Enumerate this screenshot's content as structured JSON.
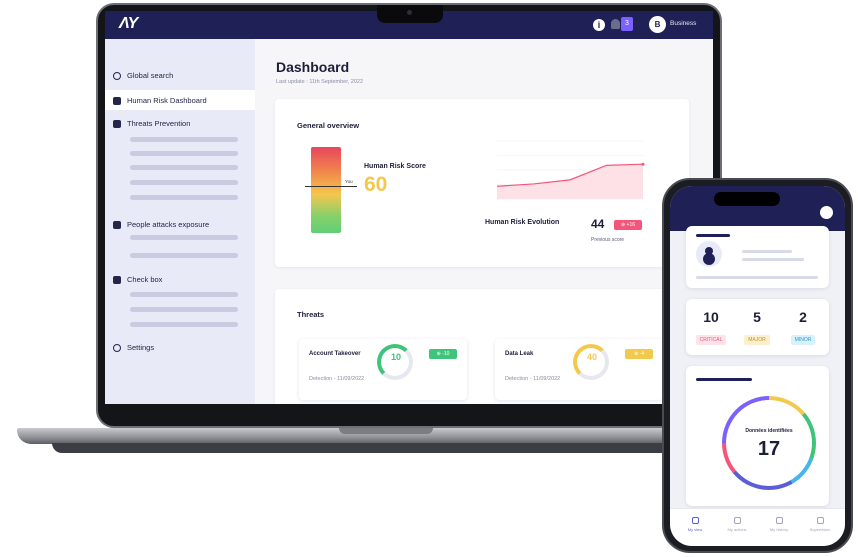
{
  "brand": {
    "logo_text": "ΛY"
  },
  "topbar": {
    "notification_count": "3",
    "avatar_initial": "B",
    "account_name": "Business"
  },
  "sidebar": {
    "items": [
      {
        "label": "Global search",
        "icon": "search-icon"
      },
      {
        "label": "Human Risk Dashboard",
        "icon": "users-icon"
      },
      {
        "label": "Threats Prevention",
        "icon": "list-icon"
      },
      {
        "label": "People attacks exposure",
        "icon": "people-icon"
      },
      {
        "label": "Check box",
        "icon": "box-icon"
      },
      {
        "label": "Settings",
        "icon": "gear-icon"
      }
    ]
  },
  "dashboard": {
    "title": "Dashboard",
    "last_update": "Last update : 11th September, 2022",
    "overview": {
      "title": "General overview",
      "gauge_you": "You",
      "human_risk_score_label": "Human Risk Score",
      "human_risk_score": "60",
      "evolution_label": "Human Risk Evolution",
      "previous_score_value": "44",
      "delta": "+16",
      "previous_score_label": "Previous score"
    },
    "threats": {
      "title": "Threats",
      "items": [
        {
          "name": "Account Takeover",
          "score": "10",
          "delta": "-10",
          "detection": "Detection - 11/09/2022",
          "color": "#3fc47a"
        },
        {
          "name": "Data Leak",
          "score": "40",
          "delta": "-4",
          "detection": "Detection - 11/09/2022",
          "color": "#f2c94c"
        }
      ]
    }
  },
  "chart_data": {
    "type": "area",
    "x": [
      1,
      2,
      3,
      4,
      5
    ],
    "values": [
      22,
      26,
      33,
      58,
      60
    ],
    "ylim": [
      0,
      100
    ],
    "grid": true
  },
  "mobile": {
    "severity": [
      {
        "count": "10",
        "label": "CRITICAL",
        "color": "#f4557a",
        "bg": "#fde3ea"
      },
      {
        "count": "5",
        "label": "MAJOR",
        "color": "#c9911c",
        "bg": "#fcefcf"
      },
      {
        "count": "2",
        "label": "MINOR",
        "color": "#2a9bc9",
        "bg": "#d9f1fb"
      }
    ],
    "donut_label": "Données identifiées",
    "donut_value": "17",
    "tabs": [
      {
        "label": "My view",
        "active": true
      },
      {
        "label": "My actions",
        "active": false
      },
      {
        "label": "My history",
        "active": false
      },
      {
        "label": "Supervision",
        "active": false
      }
    ]
  }
}
